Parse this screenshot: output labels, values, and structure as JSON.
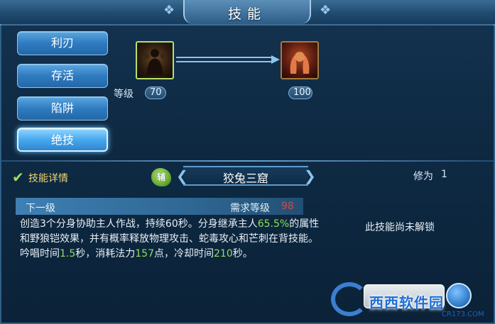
{
  "window": {
    "title": "技能"
  },
  "tabs": [
    {
      "label": "利刃",
      "active": false
    },
    {
      "label": "存活",
      "active": false
    },
    {
      "label": "陷阱",
      "active": false
    },
    {
      "label": "绝技",
      "active": true
    }
  ],
  "progression": {
    "level_label": "等级",
    "from_level": "70",
    "to_level": "100",
    "from_icon": "shadow-clone-skill-icon",
    "to_icon": "fire-hands-skill-icon"
  },
  "detail": {
    "toggle_label": "技能详情",
    "checked": true,
    "type_badge": "辅",
    "skill_name": "狡兔三窟",
    "cultivation_label": "修为",
    "cultivation_value": "1"
  },
  "next_level": {
    "label": "下一级",
    "requirement_label": "需求等级",
    "requirement_value": "98",
    "requirement_color": "#d24a3e",
    "description": {
      "p1": "创造3个分身协助主人作战，持续60秒。分身继承主人",
      "v1": "65.5%",
      "p2": "的属性和野狼铠效果，并有概率释放物理攻击、蛇毒攻心和芒刺在背技能。吟唱时间",
      "v2": "1.5",
      "p3": "秒，消耗法力",
      "v3": "157",
      "p4": "点，冷却时间",
      "v4": "210",
      "p5": "秒。"
    },
    "highlight_color": "#8fe05a"
  },
  "status": {
    "message": "此技能尚未解锁"
  },
  "watermark": {
    "text": "西西软件园",
    "sub": "CR173.COM"
  },
  "colors": {
    "panel_bg": "#0e2a44",
    "tab_blue": "#2f7bc0",
    "title_accent": "#f2d36b"
  }
}
